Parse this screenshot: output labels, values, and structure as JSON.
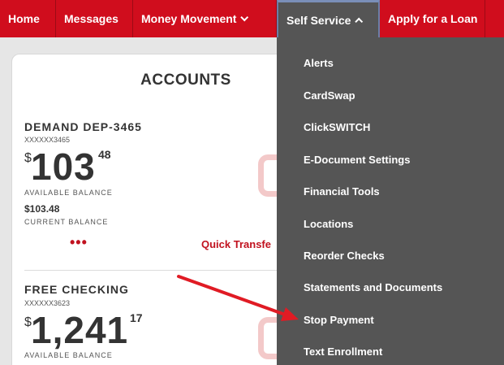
{
  "nav": {
    "items": [
      {
        "label": "Home"
      },
      {
        "label": "Messages"
      },
      {
        "label": "Money Movement"
      },
      {
        "label": "Self Service"
      },
      {
        "label": "Apply for a Loan"
      }
    ]
  },
  "accounts": {
    "title": "ACCOUNTS",
    "list": [
      {
        "name": "DEMAND DEP-3465",
        "number": "XXXXXX3465",
        "currency_symbol": "$",
        "amount_main": "103",
        "amount_cents": "48",
        "available_label": "AVAILABLE BALANCE",
        "current_value": "$103.48",
        "current_label": "CURRENT BALANCE",
        "more": "•••",
        "quick_transfer": "Quick Transfe"
      },
      {
        "name": "FREE CHECKING",
        "number": "XXXXXX3623",
        "currency_symbol": "$",
        "amount_main": "1,241",
        "amount_cents": "17",
        "available_label": "AVAILABLE BALANCE"
      }
    ]
  },
  "dropdown": {
    "items": [
      {
        "label": "Alerts"
      },
      {
        "label": "CardSwap"
      },
      {
        "label": "ClickSWITCH"
      },
      {
        "label": "E-Document Settings"
      },
      {
        "label": "Financial Tools"
      },
      {
        "label": "Locations"
      },
      {
        "label": "Reorder Checks"
      },
      {
        "label": "Statements and Documents"
      },
      {
        "label": "Stop Payment"
      },
      {
        "label": "Text Enrollment"
      }
    ]
  },
  "colors": {
    "nav_red": "#d00d1d",
    "dropdown_gray": "#555555",
    "accent_red": "#c1121f"
  }
}
